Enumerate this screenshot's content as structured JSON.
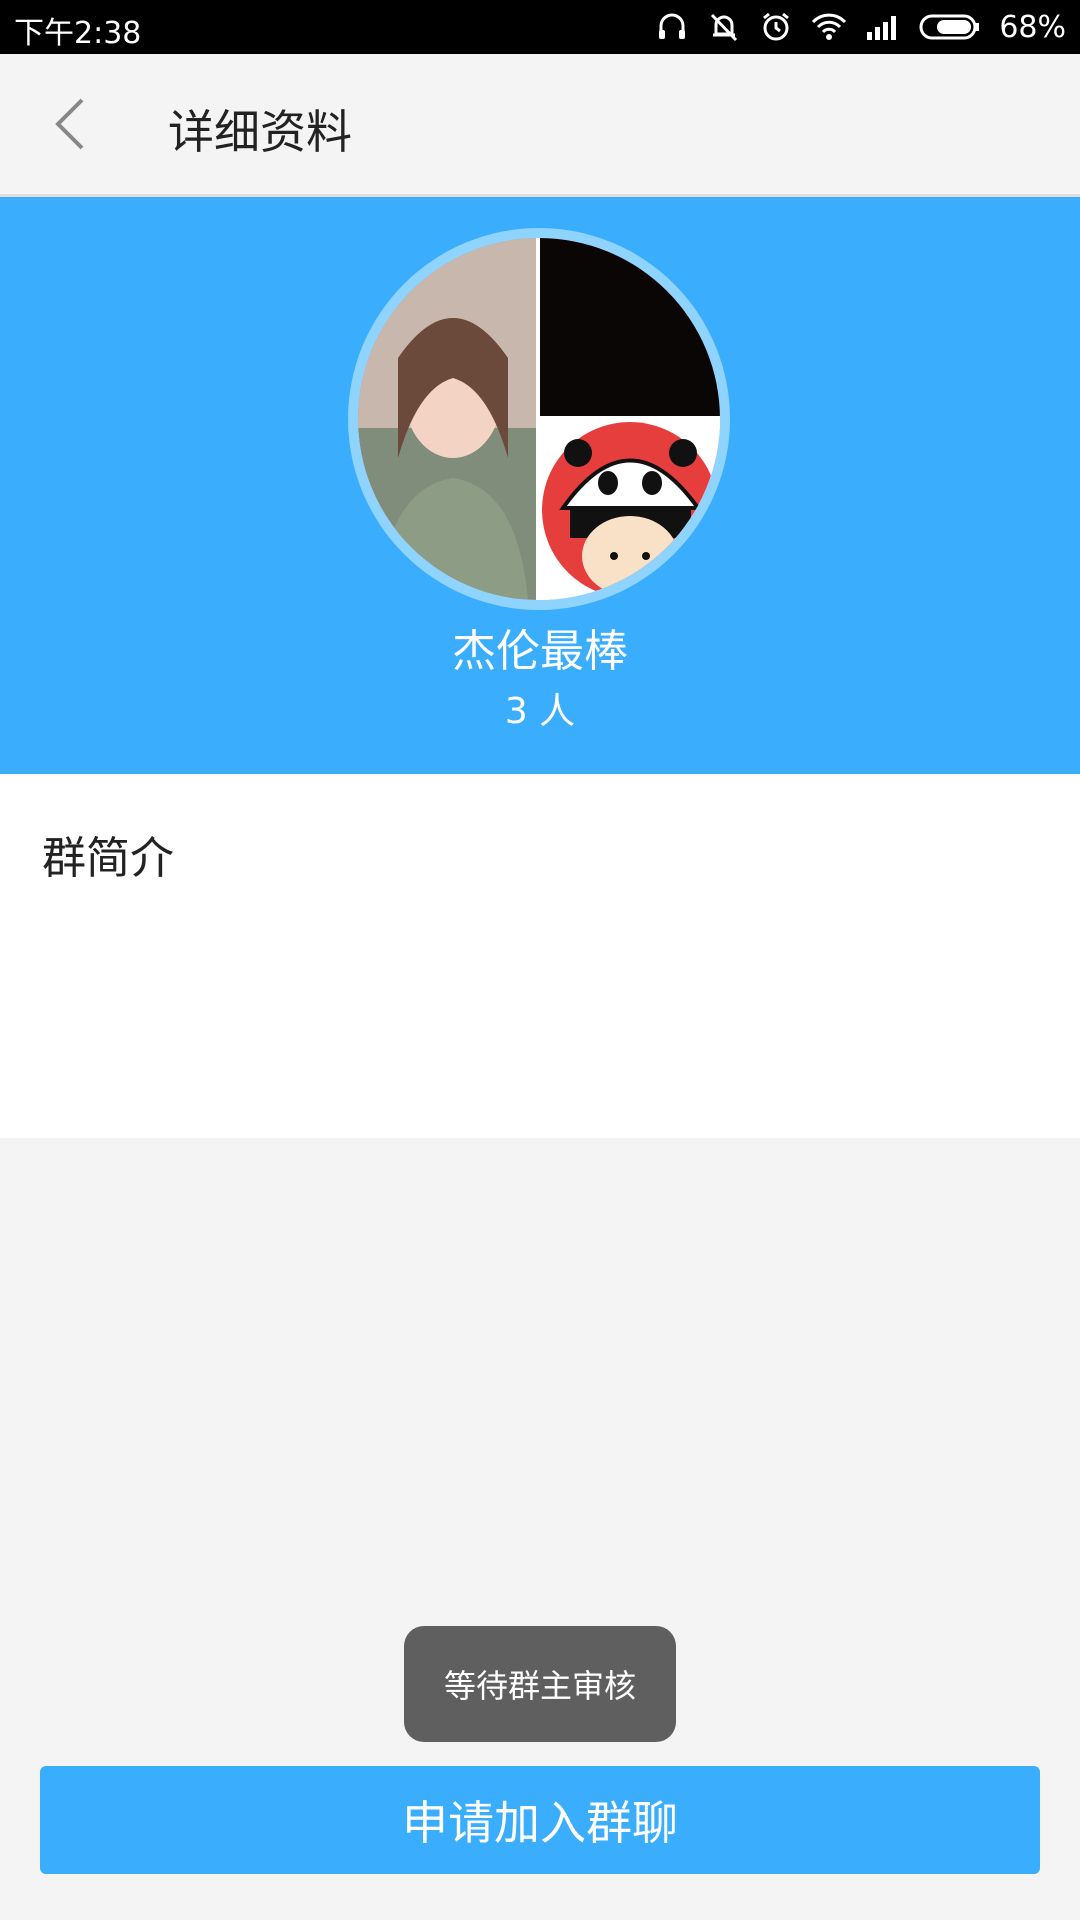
{
  "status_bar": {
    "time": "下午2:38",
    "battery_percent": "68%",
    "icons": [
      "headset-icon",
      "bell-muted-icon",
      "alarm-icon",
      "wifi-icon",
      "signal-icon",
      "battery-icon"
    ]
  },
  "header": {
    "title": "详细资料",
    "back_icon": "chevron-left-icon"
  },
  "group": {
    "name": "杰伦最棒",
    "member_count": "3 人"
  },
  "intro": {
    "title": "群简介"
  },
  "toast": {
    "text": "等待群主审核"
  },
  "actions": {
    "join_label": "申请加入群聊"
  },
  "colors": {
    "accent": "#3aaefc",
    "toast_bg": "#5f5f5f",
    "page_bg": "#f4f4f4"
  }
}
